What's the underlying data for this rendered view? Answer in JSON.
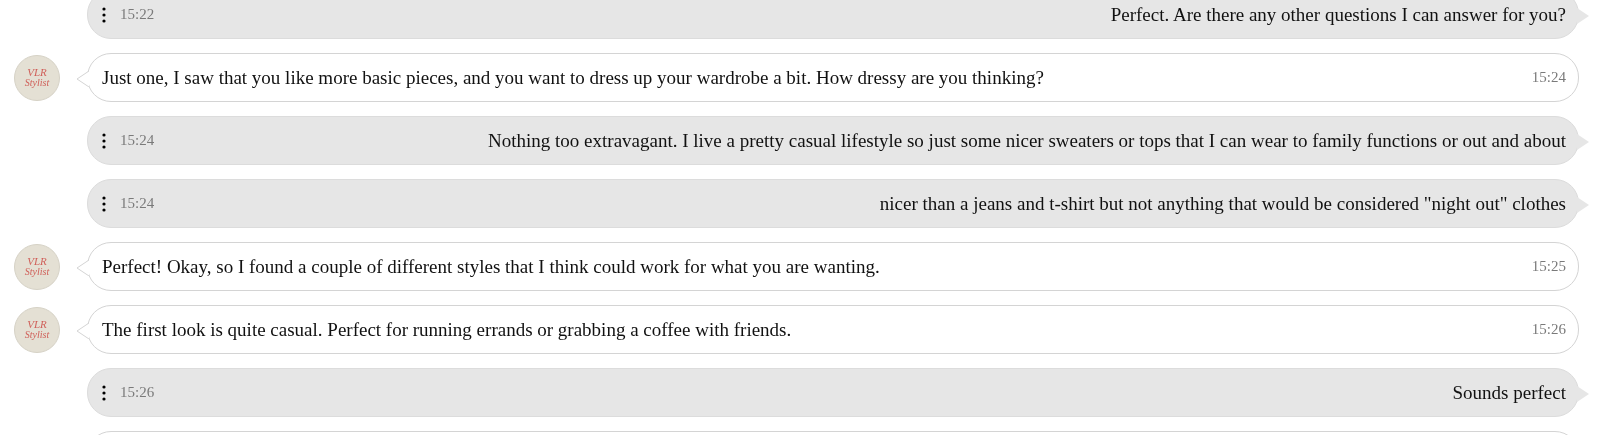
{
  "messages": [
    {
      "kind": "user",
      "time": "15:22",
      "text": "Perfect. Are there any other questions I can answer for you?"
    },
    {
      "kind": "stylist",
      "avatar": [
        "VLR",
        "Stylist"
      ],
      "time": "15:24",
      "text": "Just one, I saw that you like more basic pieces, and you want to dress up your wardrobe a bit. How dressy are you thinking?"
    },
    {
      "kind": "user",
      "time": "15:24",
      "text": "Nothing too extravagant. I live a pretty casual lifestyle so just some nicer sweaters or tops that I can wear to family functions or out and about"
    },
    {
      "kind": "user",
      "time": "15:24",
      "text": "nicer than a jeans and t-shirt but not anything that would be considered \"night out\" clothes"
    },
    {
      "kind": "stylist",
      "avatar": [
        "VLR",
        "Stylist"
      ],
      "time": "15:25",
      "text": "Perfect! Okay, so I found a couple of different styles that I think could work for what you are wanting."
    },
    {
      "kind": "stylist",
      "avatar": [
        "VLR",
        "Stylist"
      ],
      "time": "15:26",
      "text": "The first look is quite casual. Perfect for running errands or grabbing a coffee with friends."
    },
    {
      "kind": "user",
      "time": "15:26",
      "text": "Sounds perfect"
    },
    {
      "kind": "stylist"
    }
  ]
}
